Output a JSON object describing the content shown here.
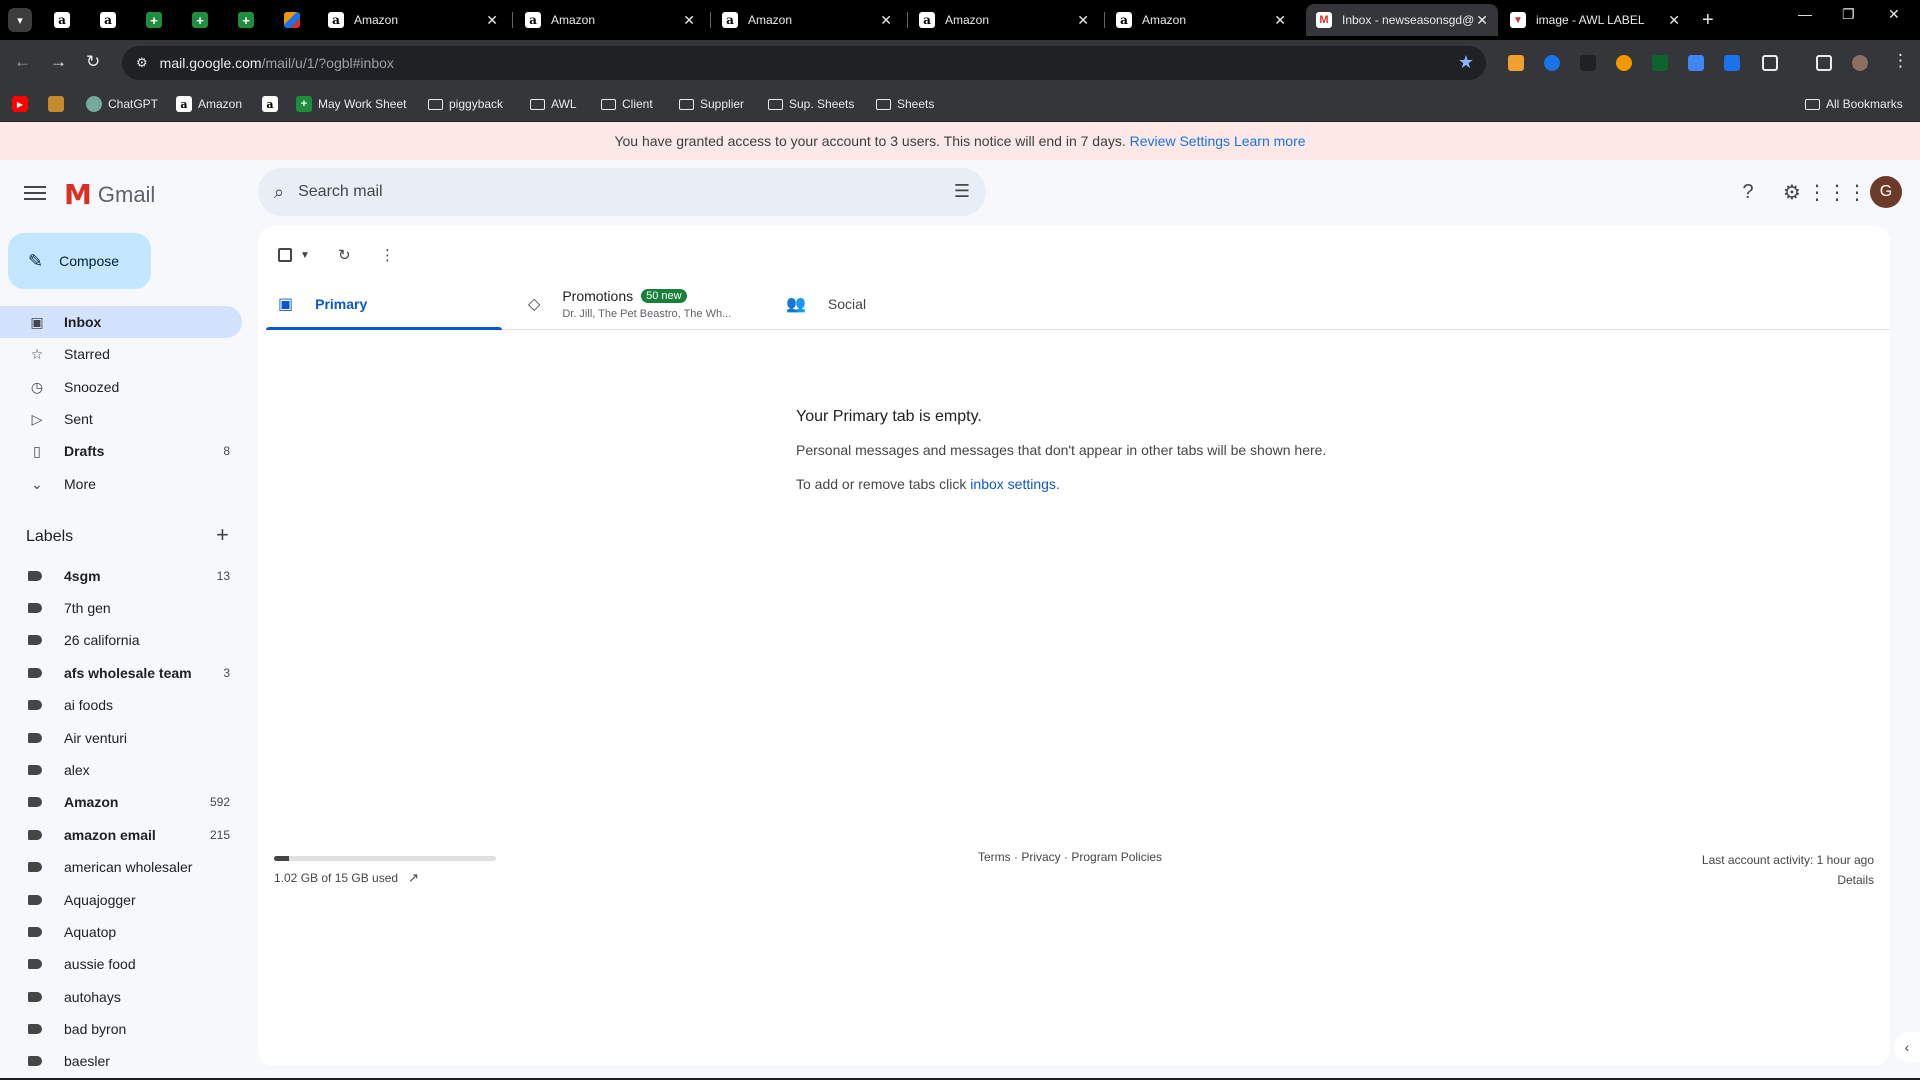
{
  "browser": {
    "pinned_tabs": [
      {
        "icon": "amazon-icon"
      },
      {
        "icon": "amazon-icon"
      },
      {
        "icon": "google-sheets-icon"
      },
      {
        "icon": "google-sheets-icon"
      },
      {
        "icon": "google-sheets-icon"
      },
      {
        "icon": "multicolor-app-icon"
      }
    ],
    "tabs": [
      {
        "title": "Amazon",
        "icon": "amazon-icon"
      },
      {
        "title": "Amazon",
        "icon": "amazon-icon"
      },
      {
        "title": "Amazon",
        "icon": "amazon-icon"
      },
      {
        "title": "Amazon",
        "icon": "amazon-icon"
      },
      {
        "title": "Amazon",
        "icon": "amazon-icon"
      },
      {
        "title": "Inbox - newseasonsgd@",
        "icon": "gmail-icon",
        "active": true
      },
      {
        "title": "image - AWL LABEL",
        "icon": "image-icon"
      }
    ],
    "url_host": "mail.google.com",
    "url_path": "/mail/u/1/?ogbl#inbox",
    "bookmarks": [
      {
        "label": "",
        "icon": "youtube-icon"
      },
      {
        "label": "",
        "icon": "extension-bookmark-icon"
      },
      {
        "label": "ChatGPT",
        "icon": "chatgpt-icon"
      },
      {
        "label": "Amazon",
        "icon": "amazon-icon"
      },
      {
        "label": "",
        "icon": "amazon-icon"
      },
      {
        "label": "May Work Sheet",
        "icon": "google-sheets-icon"
      },
      {
        "label": "piggyback",
        "icon": "folder-icon"
      },
      {
        "label": "AWL",
        "icon": "folder-icon"
      },
      {
        "label": "Client",
        "icon": "folder-icon"
      },
      {
        "label": "Supplier",
        "icon": "folder-icon"
      },
      {
        "label": "Sup. Sheets",
        "icon": "folder-icon"
      },
      {
        "label": "Sheets",
        "icon": "folder-icon"
      }
    ],
    "all_bookmarks": "All Bookmarks"
  },
  "notice": {
    "text": "You have granted access to your account to 3 users. This notice will end in 7 days.",
    "review_link": "Review Settings",
    "learn_link": "Learn more"
  },
  "header": {
    "app_name": "Gmail",
    "search_placeholder": "Search mail",
    "avatar_letter": "G"
  },
  "compose_label": "Compose",
  "nav": [
    {
      "label": "Inbox",
      "icon": "inbox-icon",
      "count": "",
      "active": true
    },
    {
      "label": "Starred",
      "icon": "star-icon",
      "count": ""
    },
    {
      "label": "Snoozed",
      "icon": "clock-icon",
      "count": ""
    },
    {
      "label": "Sent",
      "icon": "send-icon",
      "count": ""
    },
    {
      "label": "Drafts",
      "icon": "draft-icon",
      "count": "8",
      "bold": true
    },
    {
      "label": "More",
      "icon": "chevron-down-icon",
      "count": ""
    }
  ],
  "labels_title": "Labels",
  "labels": [
    {
      "name": "4sgm",
      "count": "13",
      "bold": true
    },
    {
      "name": "7th gen",
      "count": ""
    },
    {
      "name": "26 california",
      "count": ""
    },
    {
      "name": "afs wholesale team",
      "count": "3",
      "bold": true
    },
    {
      "name": "ai foods",
      "count": ""
    },
    {
      "name": "Air venturi",
      "count": ""
    },
    {
      "name": "alex",
      "count": ""
    },
    {
      "name": "Amazon",
      "count": "592",
      "bold": true
    },
    {
      "name": "amazon email",
      "count": "215",
      "bold": true
    },
    {
      "name": "american wholesaler",
      "count": ""
    },
    {
      "name": "Aquajogger",
      "count": ""
    },
    {
      "name": "Aquatop",
      "count": ""
    },
    {
      "name": "aussie food",
      "count": ""
    },
    {
      "name": "autohays",
      "count": ""
    },
    {
      "name": "bad byron",
      "count": ""
    },
    {
      "name": "baesler",
      "count": ""
    }
  ],
  "mail_tabs": {
    "primary": "Primary",
    "promotions": "Promotions",
    "promotions_badge": "50 new",
    "promotions_senders": "Dr. Jill, The Pet Beastro, The Wh...",
    "social": "Social"
  },
  "empty_state": {
    "title": "Your Primary tab is empty.",
    "line1": "Personal messages and messages that don't appear in other tabs will be shown here.",
    "line2_prefix": "To add or remove tabs click",
    "line2_link": "inbox settings."
  },
  "footer": {
    "storage_text": "1.02 GB of 15 GB used",
    "storage_fraction": 0.068,
    "terms": "Terms",
    "privacy": "Privacy",
    "policies": "Program Policies",
    "last_activity": "Last account activity: 1 hour ago",
    "details": "Details"
  }
}
